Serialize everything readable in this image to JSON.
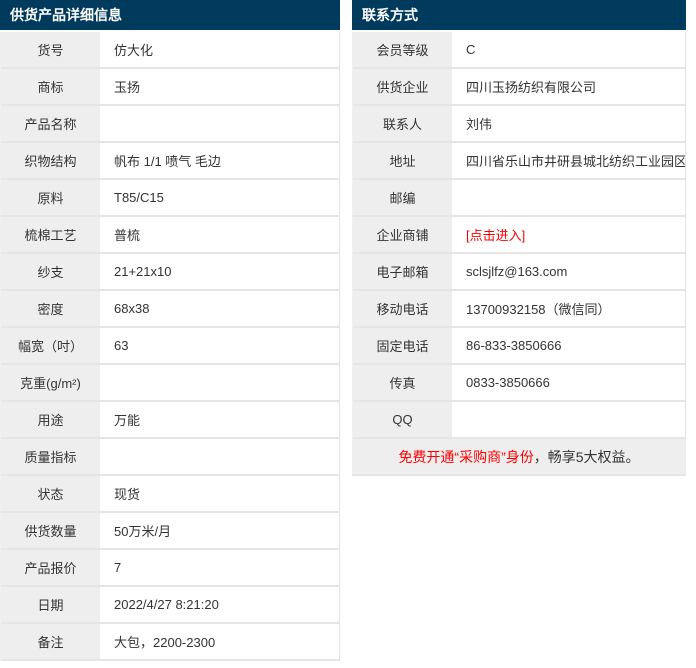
{
  "colors": {
    "header_bg": "#003a5c",
    "header_text": "#ffffff",
    "label_bg": "#eeeeee",
    "row_border": "#e5e5e5",
    "text": "#333333",
    "accent_red": "#ff0000"
  },
  "product_table": {
    "title": "供货产品详细信息",
    "rows": [
      {
        "label": "货号",
        "value": "仿大化"
      },
      {
        "label": "商标",
        "value": "玉扬"
      },
      {
        "label": "产品名称",
        "value": ""
      },
      {
        "label": "织物结构",
        "value": "帆布 1/1 喷气 毛边"
      },
      {
        "label": "原料",
        "value": "T85/C15"
      },
      {
        "label": "梳棉工艺",
        "value": "普梳"
      },
      {
        "label": "纱支",
        "value": "21+21x10"
      },
      {
        "label": "密度",
        "value": "68x38"
      },
      {
        "label": "幅宽（吋）",
        "value": "63"
      },
      {
        "label": "克重(g/m²)",
        "value": ""
      },
      {
        "label": "用途",
        "value": "万能"
      },
      {
        "label": "质量指标",
        "value": ""
      },
      {
        "label": "状态",
        "value": "现货"
      },
      {
        "label": "供货数量",
        "value": "50万米/月"
      },
      {
        "label": "产品报价",
        "value": "7"
      },
      {
        "label": "日期",
        "value": "2022/4/27 8:21:20"
      },
      {
        "label": "备注",
        "value": "大包，2200-2300"
      }
    ]
  },
  "contact_table": {
    "title": "联系方式",
    "rows": [
      {
        "label": "会员等级",
        "value": "C"
      },
      {
        "label": "供货企业",
        "value": "四川玉扬纺织有限公司"
      },
      {
        "label": "联系人",
        "value": "刘伟"
      },
      {
        "label": "地址",
        "value": "四川省乐山市井研县城北纺织工业园区"
      },
      {
        "label": "邮编",
        "value": ""
      },
      {
        "label": "企业商铺",
        "value": "[点击进入]",
        "type": "link",
        "link_name": "shop-enter-link"
      },
      {
        "label": "电子邮箱",
        "value": "sclsjlfz@163.com"
      },
      {
        "label": "移动电话",
        "value": "13700932158（微信同）"
      },
      {
        "label": "固定电话",
        "value": "86-833-3850666"
      },
      {
        "label": "传真",
        "value": "0833-3850666"
      },
      {
        "label": "QQ",
        "value": ""
      }
    ],
    "notice": {
      "highlight": "免费开通“采购商”身份",
      "rest": "，畅享5大权益。"
    }
  }
}
